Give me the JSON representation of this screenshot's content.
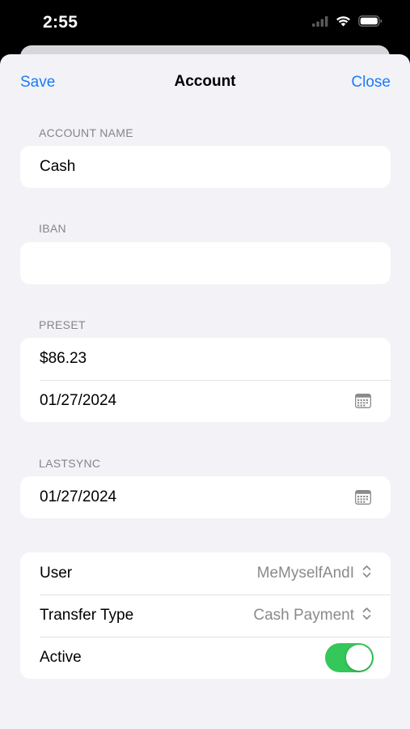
{
  "status_bar": {
    "time": "2:55",
    "icons": [
      "signal-icon",
      "wifi-icon",
      "battery-icon"
    ]
  },
  "nav": {
    "save_label": "Save",
    "title": "Account",
    "close_label": "Close"
  },
  "sections": {
    "account_name": {
      "header": "ACCOUNT NAME",
      "value": "Cash"
    },
    "iban": {
      "header": "IBAN",
      "value": ""
    },
    "preset": {
      "header": "PRESET",
      "amount": "$86.23",
      "date": "01/27/2024"
    },
    "lastsync": {
      "header": "LASTSYNC",
      "date": "01/27/2024"
    },
    "options": {
      "user_label": "User",
      "user_value": "MeMyselfAndI",
      "transfer_label": "Transfer Type",
      "transfer_value": "Cash Payment",
      "active_label": "Active",
      "active_on": true
    }
  },
  "colors": {
    "accent": "#1a7cf3",
    "toggle_on": "#34c759",
    "background": "#f2f2f7",
    "secondary_text": "#8a8a8e"
  }
}
